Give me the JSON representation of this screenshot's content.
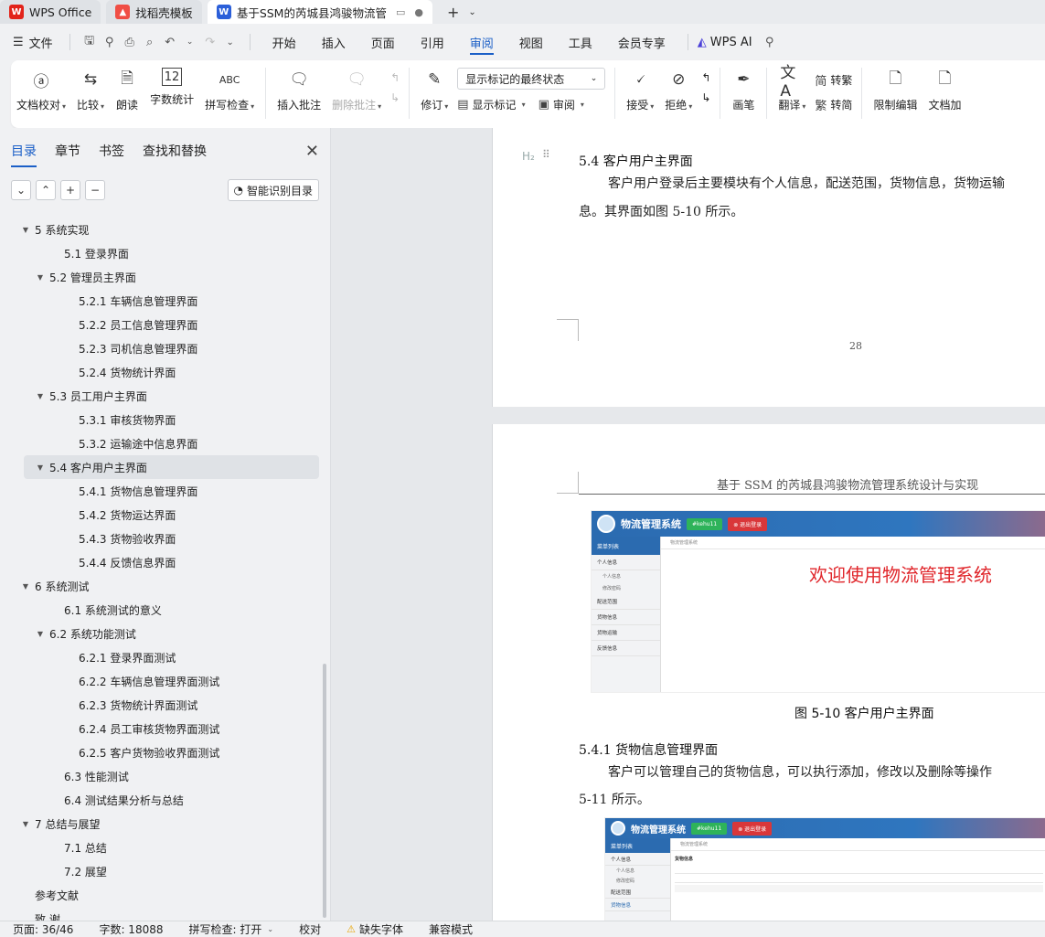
{
  "titlebar": {
    "tabs": [
      {
        "label": "WPS Office",
        "icon": "wps-logo-icon"
      },
      {
        "label": "找稻壳模板",
        "icon": "docer-icon"
      },
      {
        "label": "基于SSM的芮城县鸿骏物流管",
        "icon": "wps-writer-icon"
      }
    ],
    "new_tab": "+"
  },
  "menubar": {
    "file_label": "文件",
    "tabs": [
      "开始",
      "插入",
      "页面",
      "引用",
      "审阅",
      "视图",
      "工具",
      "会员专享"
    ],
    "active_tab": "审阅",
    "ai_label": "WPS AI"
  },
  "ribbon": {
    "doc_check": "文档校对",
    "compare": "比较",
    "read_aloud": "朗读",
    "word_count": "字数统计",
    "spell_check": "拼写检查",
    "insert_comment": "插入批注",
    "delete_comment": "删除批注",
    "track_changes": "修订",
    "markup_select": "显示标记的最终状态",
    "show_markup": "显示标记",
    "review": "审阅",
    "accept": "接受",
    "reject": "拒绝",
    "pen": "画笔",
    "translate": "翻译",
    "to_traditional": "转繁",
    "to_simplified": "转简",
    "restrict_edit": "限制编辑",
    "doc_encrypt": "文档加"
  },
  "sidebar": {
    "tabs": [
      "目录",
      "章节",
      "书签",
      "查找和替换"
    ],
    "active_tab": "目录",
    "smart_toc": "智能识别目录",
    "toc": [
      {
        "label": "5 系统实现",
        "level": "l1",
        "arrow": "▼"
      },
      {
        "label": "5.1 登录界面",
        "level": "l2",
        "arrow": ""
      },
      {
        "label": "5.2  管理员主界面",
        "level": "l2a",
        "arrow": "▼"
      },
      {
        "label": "5.2.1 车辆信息管理界面",
        "level": "l3",
        "arrow": ""
      },
      {
        "label": "5.2.2 员工信息管理界面",
        "level": "l3",
        "arrow": ""
      },
      {
        "label": "5.2.3 司机信息管理界面",
        "level": "l3",
        "arrow": ""
      },
      {
        "label": "5.2.4 货物统计界面",
        "level": "l3",
        "arrow": ""
      },
      {
        "label": "5.3  员工用户主界面",
        "level": "l2a",
        "arrow": "▼"
      },
      {
        "label": "5.3.1  审核货物界面",
        "level": "l3",
        "arrow": ""
      },
      {
        "label": "5.3.2  运输途中信息界面",
        "level": "l3",
        "arrow": ""
      },
      {
        "label": "5.4  客户用户主界面",
        "level": "l2a",
        "arrow": "▼",
        "selected": true
      },
      {
        "label": "5.4.1  货物信息管理界面",
        "level": "l3",
        "arrow": ""
      },
      {
        "label": "5.4.2  货物运达界面",
        "level": "l3",
        "arrow": ""
      },
      {
        "label": "5.4.3  货物验收界面",
        "level": "l3",
        "arrow": ""
      },
      {
        "label": "5.4.4  反馈信息界面",
        "level": "l3",
        "arrow": ""
      },
      {
        "label": "6 系统测试",
        "level": "l1",
        "arrow": "▼"
      },
      {
        "label": "6.1 系统测试的意义",
        "level": "l2",
        "arrow": ""
      },
      {
        "label": "6.2  系统功能测试",
        "level": "l2a",
        "arrow": "▼"
      },
      {
        "label": "6.2.1 登录界面测试",
        "level": "l3",
        "arrow": ""
      },
      {
        "label": "6.2.2  车辆信息管理界面测试",
        "level": "l3",
        "arrow": ""
      },
      {
        "label": "6.2.3 货物统计界面测试",
        "level": "l3",
        "arrow": ""
      },
      {
        "label": "6.2.4  员工审核货物界面测试",
        "level": "l3",
        "arrow": ""
      },
      {
        "label": "6.2.5  客户货物验收界面测试",
        "level": "l3",
        "arrow": ""
      },
      {
        "label": "6.3  性能测试",
        "level": "l2",
        "arrow": ""
      },
      {
        "label": "6.4  测试结果分析与总结",
        "level": "l2",
        "arrow": ""
      },
      {
        "label": "7 总结与展望",
        "level": "l1",
        "arrow": "▼"
      },
      {
        "label": "7.1  总结",
        "level": "l2",
        "arrow": ""
      },
      {
        "label": "7.2  展望",
        "level": "l2",
        "arrow": ""
      },
      {
        "label": "参考文献",
        "level": "l1",
        "arrow": ""
      },
      {
        "label": "致    谢",
        "level": "l1",
        "arrow": ""
      }
    ]
  },
  "document": {
    "page1": {
      "heading": "5.4  客户用户主界面",
      "h2_marker": "H₂",
      "para_line1": "客户用户登录后主要模块有个人信息，配送范围，货物信息，货物运输",
      "para_line2": "息。其界面如图 5-10 所示。",
      "page_number": "28"
    },
    "page2": {
      "header": "基于 SSM 的芮城县鸿骏物流管理系统设计与实现",
      "figure_caption": "图 5-10 客户用户主界面",
      "subheading": "5.4.1  货物信息管理界面",
      "para_line1": "客户可以管理自己的货物信息，可以执行添加，修改以及删除等操作",
      "para_line2": "5-11 所示。"
    },
    "shot1": {
      "system_title": "物流管理系统",
      "user_btn": "#kehu11",
      "logout_btn": "⊗ 退出登录",
      "menu_header": "菜单列表",
      "breadcrumb": "物流管理系统",
      "welcome": "欢迎使用物流管理系统",
      "menu": [
        "个人信息",
        "配送范围",
        "货物信息",
        "货物运输",
        "反馈信息"
      ],
      "submenu": [
        "个人信息",
        "修改密码"
      ]
    },
    "shot2": {
      "system_title": "物流管理系统",
      "user_btn": "#kehu11",
      "logout_btn": "⊗ 退出登录",
      "menu_header": "菜单列表",
      "breadcrumb": "物流管理系统",
      "menu": [
        "个人信息",
        "配送范围",
        "货物信息"
      ],
      "submenu": [
        "个人信息",
        "修改密码"
      ],
      "panel_title": "货物信息"
    }
  },
  "statusbar": {
    "page": "页面: 36/46",
    "words": "字数: 18088",
    "spell": "拼写检查: 打开",
    "proof": "校对",
    "missing_font": "缺失字体",
    "compat": "兼容模式"
  }
}
